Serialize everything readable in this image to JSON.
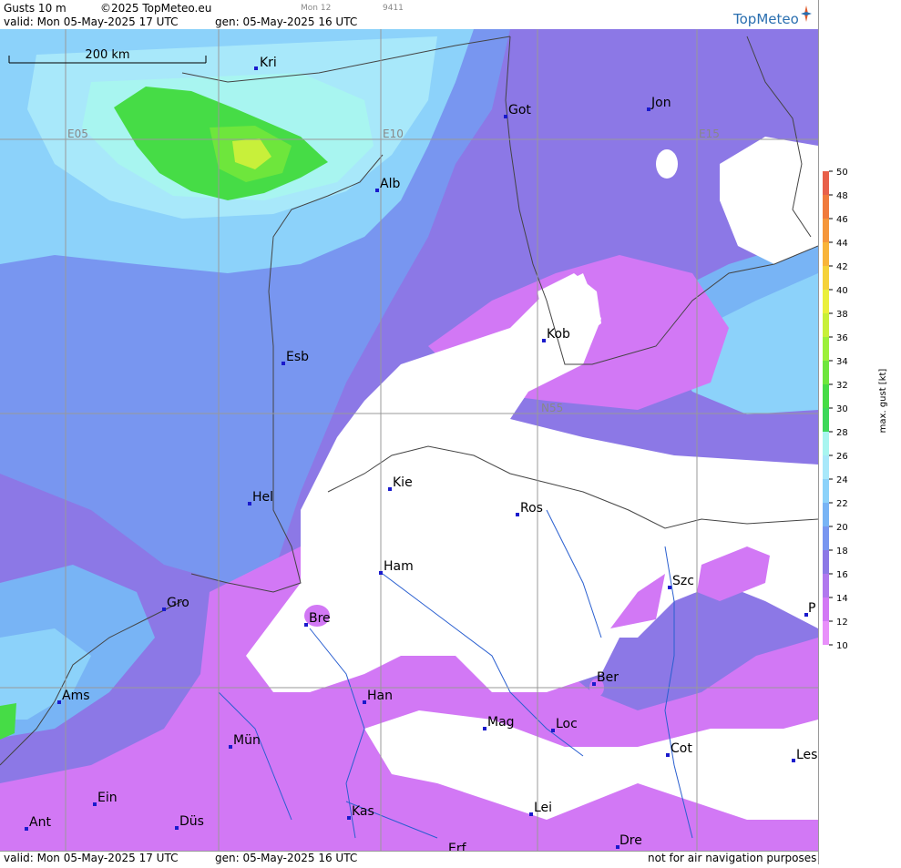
{
  "header": {
    "product": "Gusts 10 m",
    "copyright": "©2025 TopMeteo.eu",
    "day_code": "Mon 12",
    "run_code": "9411",
    "valid": "valid:  Mon  05-May-2025  17 UTC",
    "gen": "gen:  05-May-2025 16 UTC",
    "brand": "TopMeteo"
  },
  "footer": {
    "valid": "valid:  Mon  05-May-2025  17 UTC",
    "gen": "gen:  05-May-2025 16 UTC",
    "disclaimer": "not for air navigation purposes"
  },
  "scale_bar": "200 km",
  "grid_labels": [
    "E05",
    "E10",
    "E15",
    "N55"
  ],
  "cities": [
    "Kri",
    "Got",
    "Jon",
    "Alb",
    "Kob",
    "Esb",
    "Kie",
    "Ros",
    "Hel",
    "Ham",
    "Szc",
    "Gro",
    "Bre",
    "P",
    "Ber",
    "Ams",
    "Han",
    "Mag",
    "Loc",
    "Mün",
    "Cot",
    "Les",
    "Ein",
    "Kas",
    "Lei",
    "Ant",
    "Düs",
    "Dre",
    "Erf"
  ],
  "legend": {
    "title": "max.  gust  [kt]",
    "ticks": [
      "50",
      "48",
      "46",
      "44",
      "42",
      "40",
      "38",
      "36",
      "34",
      "32",
      "30",
      "28",
      "26",
      "24",
      "22",
      "20",
      "18",
      "16",
      "14",
      "12",
      "10"
    ],
    "colors": [
      "#e8604a",
      "#f07a3c",
      "#f5963a",
      "#f8b43a",
      "#f5d23a",
      "#eaf03c",
      "#c8f03a",
      "#9cf03a",
      "#6ee63c",
      "#46dc46",
      "#3cd85a",
      "#a8f5f0",
      "#a8e8fa",
      "#8cd2fa",
      "#78b4f5",
      "#7896f0",
      "#8c78e6",
      "#b078ee",
      "#d278f5",
      "#e890fa"
    ]
  }
}
